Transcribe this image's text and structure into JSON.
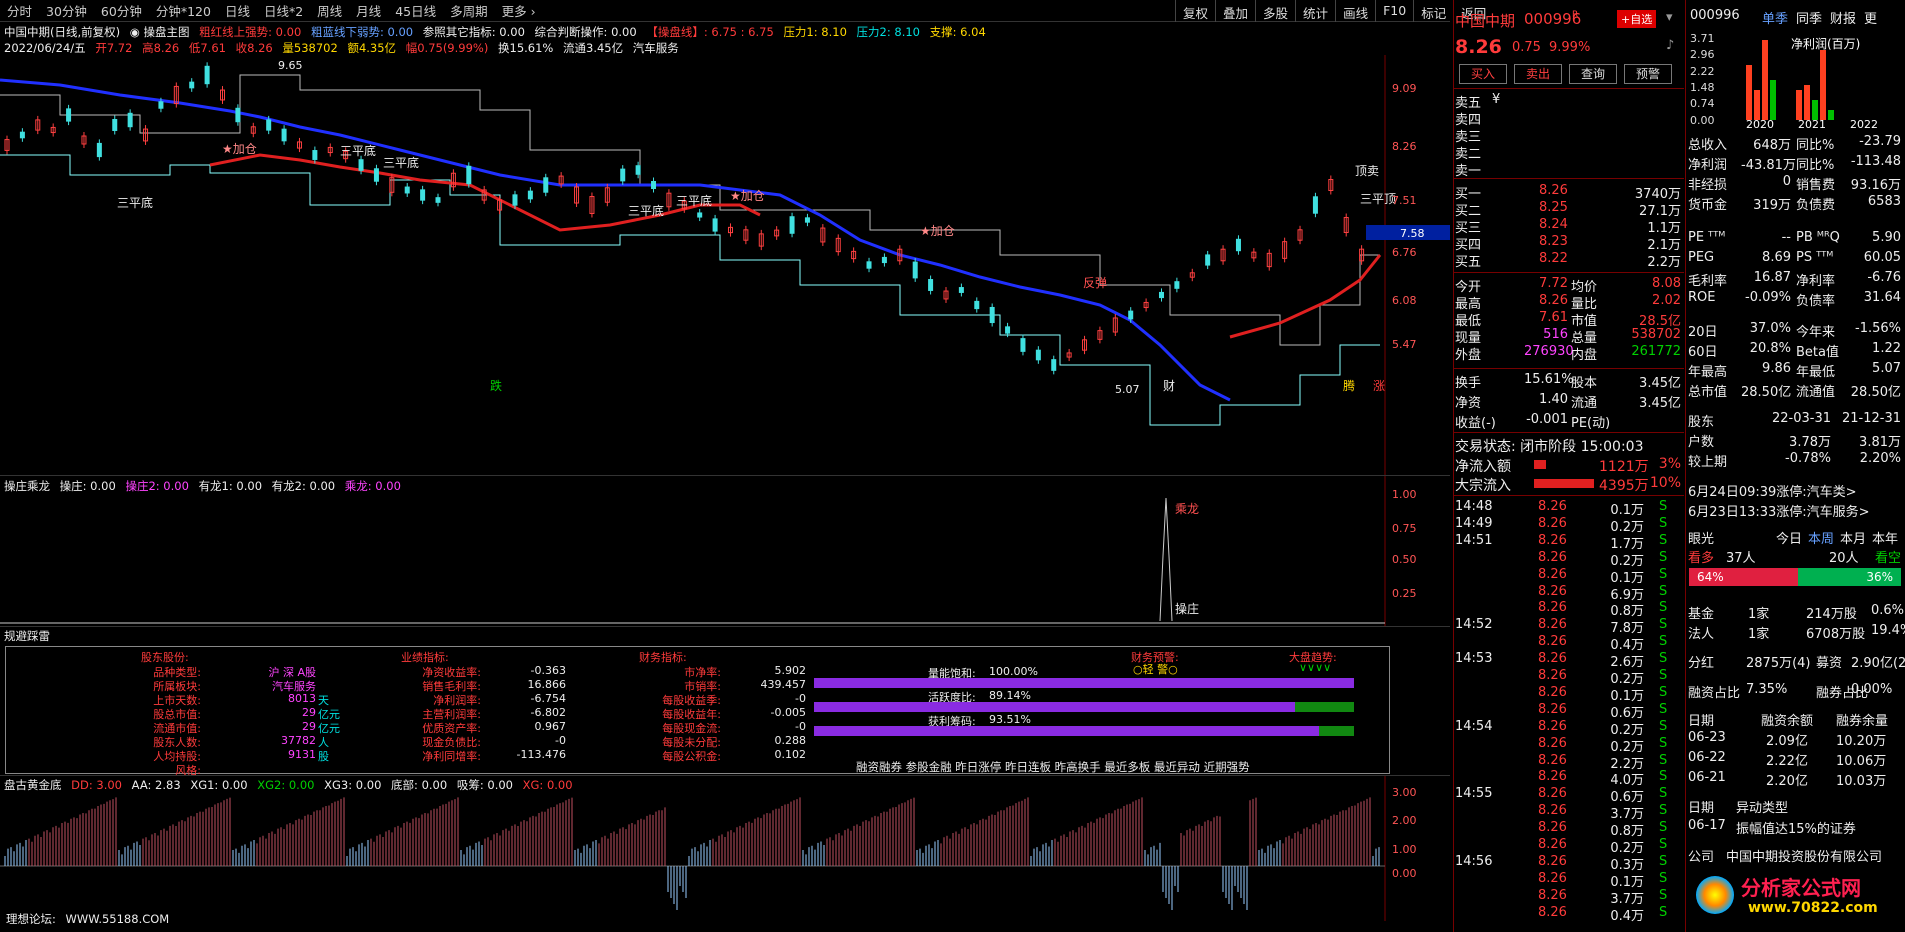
{
  "toolbar": {
    "periods": [
      "分时",
      "30分钟",
      "60分钟",
      "分钟*120",
      "日线",
      "日线*2",
      "周线",
      "月线",
      "45日线",
      "多周期",
      "更多 ›"
    ],
    "right": [
      "复权",
      "叠加",
      "多股",
      "统计",
      "画线",
      "F10",
      "标记",
      "返回"
    ]
  },
  "chart": {
    "title": "中国中期(日线,前复权)",
    "indicator": "◉ 操盘主图",
    "legend": [
      "粗红线上强势: 0.00",
      "粗蓝线下弱势: 0.00",
      "参照其它指标: 0.00",
      "综合判断操作: 0.00",
      "【操盘线】: 6.75 : 6.75",
      "压力1: 8.10",
      "压力2: 8.10",
      "支撑: 6.04"
    ],
    "info": {
      "date": "2022/06/24/五",
      "open": "开7.72",
      "high": "高8.26",
      "low": "低7.61",
      "close": "收8.26",
      "vol": "量538702",
      "amount": "额4.35亿",
      "change": "幅0.75(9.99%)",
      "turn": "换15.61%",
      "float": "流通3.45亿",
      "sector": "汽车服务"
    },
    "yticks": [
      "9.09",
      "8.26",
      "7.51",
      "6.76",
      "6.08",
      "5.47"
    ],
    "price_tag": "7.58",
    "max_label": "9.65",
    "min_label": "5.07",
    "signals": {
      "sanpingdi": "三平底",
      "jiacang": "★加仓",
      "fantan": "反弹",
      "ding": "顶卖",
      "zhang": "涨",
      "die": "跌",
      "cai": "财",
      "teng": "腾",
      "sanpingding": "三平顶"
    }
  },
  "panel2": {
    "name": "操庄乘龙",
    "legend": [
      "操庄: 0.00",
      "操庄2: 0.00",
      "有龙1: 0.00",
      "有龙2: 0.00",
      "乘龙: 0.00"
    ],
    "yticks": [
      "1.00",
      "0.75",
      "0.50",
      "0.25"
    ],
    "labels": [
      "乘龙",
      "操庄"
    ]
  },
  "panel3": {
    "name": "规避踩雷",
    "col1_title": "股东股份:",
    "col1": [
      [
        "品种类型:",
        "沪 深 A股",
        ""
      ],
      [
        "所属板块:",
        "汽车服务",
        ""
      ],
      [
        "上市天数:",
        "8013",
        "天"
      ],
      [
        "股总市值:",
        "29",
        "亿元"
      ],
      [
        "流通市值:",
        "29",
        "亿元"
      ],
      [
        "股东人数:",
        "37782",
        "人"
      ],
      [
        "人均持股:",
        "9131",
        "股"
      ],
      [
        "风格:",
        "",
        ""
      ]
    ],
    "col2_title": "业绩指标:",
    "col2": [
      [
        "净资收益率:",
        "-0.363"
      ],
      [
        "销售毛利率:",
        "16.866"
      ],
      [
        "净利润率:",
        "-6.754"
      ],
      [
        "主营利润率:",
        "-6.802"
      ],
      [
        "优质资产率:",
        "0.967"
      ],
      [
        "现金负债比:",
        "-0"
      ],
      [
        "净利同增率:",
        "-113.476"
      ]
    ],
    "col3_title": "财务指标:",
    "col3": [
      [
        "市净率:",
        "5.902"
      ],
      [
        "市销率:",
        "439.457"
      ],
      [
        "每股收益季:",
        "-0"
      ],
      [
        "每股收益年:",
        "-0.005"
      ],
      [
        "每股现金流:",
        "-0"
      ],
      [
        "每股未分配:",
        "0.288"
      ],
      [
        "每股公积金:",
        "0.102"
      ]
    ],
    "meters": [
      {
        "label": "量能饱和:",
        "value": "100.00%",
        "fill": 1.0
      },
      {
        "label": "活跃度比:",
        "value": "89.14%",
        "fill": 0.8914
      },
      {
        "label": "获利筹码:",
        "value": "93.51%",
        "fill": 0.9351
      }
    ],
    "warn_title": "财务预警:",
    "warn": "○轻 警○",
    "trend_title": "大盘趋势:",
    "trend": "∨∨∨∨",
    "links": "融资融券 参股金融 昨日涨停 昨日连板 昨高换手 最近多板 最近异动 近期强势"
  },
  "panel4": {
    "name": "盘古黄金底",
    "legend": [
      "DD: 3.00",
      "AA: 2.83",
      "XG1: 0.00",
      "XG2: 0.00",
      "XG3: 0.00",
      "底部: 0.00",
      "吸筹: 0.00",
      "XG: 0.00"
    ],
    "yticks": [
      "3.00",
      "2.00",
      "1.00",
      "0.00"
    ]
  },
  "footer": {
    "forum": "理想论坛:",
    "url": "WWW.55188.COM"
  },
  "quote": {
    "name": "中国中期",
    "code": "000996",
    "flag": "R",
    "add": "+自选",
    "price": "8.26",
    "chg": "0.75",
    "pct": "9.99%",
    "buttons": [
      "买入",
      "卖出",
      "查询",
      "预警"
    ],
    "asks": [
      "卖五",
      "卖四",
      "卖三",
      "卖二",
      "卖一"
    ],
    "ask_sym": "¥",
    "bids": [
      [
        "买一",
        "8.26",
        "3740万"
      ],
      [
        "买二",
        "8.25",
        "27.1万"
      ],
      [
        "买三",
        "8.24",
        "1.1万"
      ],
      [
        "买四",
        "8.23",
        "2.1万"
      ],
      [
        "买五",
        "8.22",
        "2.2万"
      ]
    ],
    "stats": [
      [
        "今开",
        "7.72",
        "均价",
        "8.08"
      ],
      [
        "最高",
        "8.26",
        "量比",
        "2.02"
      ],
      [
        "最低",
        "7.61",
        "市值",
        "28.5亿"
      ],
      [
        "现量",
        "516",
        "总量",
        "538702"
      ],
      [
        "外盘",
        "276930",
        "内盘",
        "261772"
      ]
    ],
    "stats2": [
      [
        "换手",
        "15.61%",
        "股本",
        "3.45亿"
      ],
      [
        "净资",
        "1.40",
        "流通",
        "3.45亿"
      ],
      [
        "收益(-)",
        "-0.001",
        "PE(动)",
        ""
      ]
    ],
    "status": "交易状态: 闭市阶段 15:00:03",
    "flows": [
      [
        "净流入额",
        "1121万",
        "3%"
      ],
      [
        "大宗流入",
        "4395万",
        "10%"
      ]
    ],
    "ticks": [
      [
        "14:48",
        "8.26",
        "0.1万",
        "S"
      ],
      [
        "14:49",
        "8.26",
        "0.2万",
        "S"
      ],
      [
        "14:51",
        "8.26",
        "1.7万",
        "S"
      ],
      [
        "",
        "8.26",
        "0.2万",
        "S"
      ],
      [
        "",
        "8.26",
        "0.1万",
        "S"
      ],
      [
        "",
        "8.26",
        "6.9万",
        "S"
      ],
      [
        "",
        "8.26",
        "0.8万",
        "S"
      ],
      [
        "14:52",
        "8.26",
        "7.8万",
        "S"
      ],
      [
        "",
        "8.26",
        "0.4万",
        "S"
      ],
      [
        "14:53",
        "8.26",
        "2.6万",
        "S"
      ],
      [
        "",
        "8.26",
        "0.2万",
        "S"
      ],
      [
        "",
        "8.26",
        "0.1万",
        "S"
      ],
      [
        "",
        "8.26",
        "0.6万",
        "S"
      ],
      [
        "14:54",
        "8.26",
        "0.2万",
        "S"
      ],
      [
        "",
        "8.26",
        "0.2万",
        "S"
      ],
      [
        "",
        "8.26",
        "2.2万",
        "S"
      ],
      [
        "",
        "8.26",
        "4.0万",
        "S"
      ],
      [
        "14:55",
        "8.26",
        "0.6万",
        "S"
      ],
      [
        "",
        "8.26",
        "3.7万",
        "S"
      ],
      [
        "",
        "8.26",
        "0.8万",
        "S"
      ],
      [
        "",
        "8.26",
        "0.2万",
        "S"
      ],
      [
        "14:56",
        "8.26",
        "0.3万",
        "S"
      ],
      [
        "",
        "8.26",
        "0.1万",
        "S"
      ],
      [
        "",
        "8.26",
        "3.7万",
        "S"
      ],
      [
        "",
        "8.26",
        "0.4万",
        "S"
      ]
    ]
  },
  "f10": {
    "code": "000996",
    "tabs": [
      "单季",
      "同季",
      "财报",
      "更"
    ],
    "chart_label": "净利润(百万)",
    "yticks": [
      "3.71",
      "2.96",
      "2.22",
      "1.48",
      "0.74",
      "0.00"
    ],
    "years": [
      "2020",
      "2021",
      "2022"
    ],
    "rows": [
      [
        "总收入",
        "648万",
        "同比%",
        "-23.79"
      ],
      [
        "净利润",
        "-43.81万",
        "同比%",
        "-113.48"
      ],
      [
        "非经损",
        "0",
        "销售费",
        "93.16万"
      ],
      [
        "货币金",
        "319万",
        "负债费",
        "6583"
      ]
    ],
    "rows2": [
      [
        "PE ᵀᵀᴹ",
        "--",
        "PB ᴹᴿQ",
        "5.90"
      ],
      [
        "PEG",
        "8.69",
        "PS ᵀᵀᴹ",
        "60.05"
      ],
      [
        "毛利率",
        "16.87",
        "净利率",
        "-6.76"
      ],
      [
        "ROE",
        "-0.09%",
        "负债率",
        "31.64"
      ]
    ],
    "rows3": [
      [
        "20日",
        "37.0%",
        "今年来",
        "-1.56%"
      ],
      [
        "60日",
        "20.8%",
        "Beta值",
        "1.22"
      ],
      [
        "年最高",
        "9.86",
        "年最低",
        "5.07"
      ],
      [
        "总市值",
        "28.50亿",
        "流通值",
        "28.50亿"
      ]
    ],
    "rows4": [
      [
        "股东",
        "22-03-31",
        "21-12-31"
      ],
      [
        "户数",
        "3.78万",
        "3.81万"
      ],
      [
        "较上期",
        "-0.78%",
        "2.20%"
      ]
    ],
    "news": [
      "6月24日09:39涨停:汽车类>",
      "6月23日13:33涨停:汽车服务>"
    ],
    "sent": {
      "label": "眼光",
      "tabs": [
        "今日",
        "本周",
        "本月",
        "本年"
      ],
      "bull": "看多",
      "bull_n": "37人",
      "bear_n": "20人",
      "bear": "看空",
      "bull_pct": "64%",
      "bear_pct": "36%",
      "bull_fill": 0.64
    },
    "funds": [
      [
        "基金",
        "1家",
        "214万股",
        "0.6%"
      ],
      [
        "法人",
        "1家",
        "6708万股",
        "19.4%"
      ]
    ],
    "div": [
      "分红",
      "2875万(4)",
      "募资",
      "2.90亿(2)"
    ],
    "margin": [
      "融资占比",
      "7.35%",
      "融券占比",
      "0.00%"
    ],
    "margin_head": [
      "日期",
      "融资余额",
      "融券余量"
    ],
    "margin_rows": [
      [
        "06-23",
        "2.09亿",
        "10.20万"
      ],
      [
        "06-22",
        "2.22亿",
        "10.06万"
      ],
      [
        "06-21",
        "2.20亿",
        "10.03万"
      ]
    ],
    "abn_head": [
      "日期",
      "异动类型"
    ],
    "abn_rows": [
      [
        "06-17",
        "振幅值达15%的证券"
      ]
    ],
    "company": [
      "公司",
      "中国中期投资股份有限公司"
    ],
    "watermark": "分析家公式网",
    "watermark_url": "www.70822.com"
  }
}
